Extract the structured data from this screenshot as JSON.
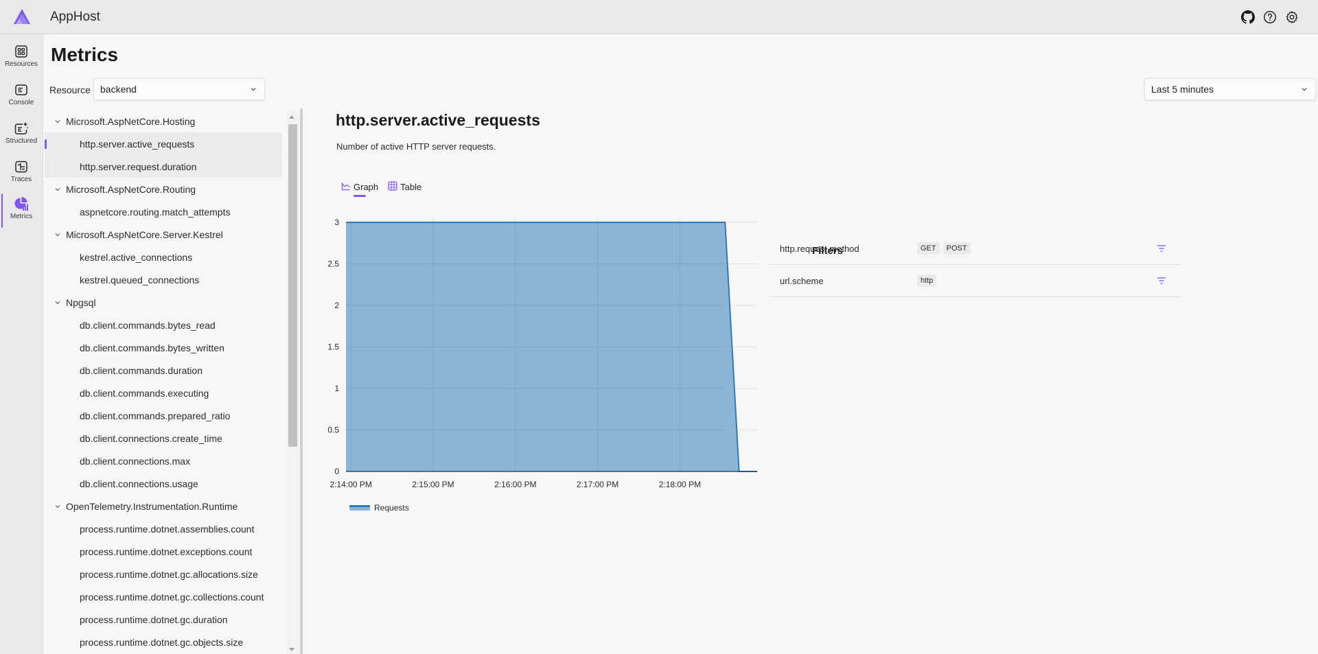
{
  "app": {
    "title": "AppHost"
  },
  "topbar": {
    "icons": [
      {
        "name": "github-icon",
        "label": "GitHub"
      },
      {
        "name": "help-icon",
        "label": "Help"
      },
      {
        "name": "settings-icon",
        "label": "Settings"
      }
    ]
  },
  "nav": {
    "items": [
      {
        "label": "Resources",
        "icon": "resources-icon",
        "active": false
      },
      {
        "label": "Console",
        "icon": "console-icon",
        "active": false
      },
      {
        "label": "Structured",
        "icon": "structured-logs-icon",
        "active": false
      },
      {
        "label": "Traces",
        "icon": "traces-icon",
        "active": false
      },
      {
        "label": "Metrics",
        "icon": "metrics-icon",
        "active": true
      }
    ]
  },
  "page": {
    "title": "Metrics",
    "resource_label": "Resource",
    "resource_value": "backend",
    "time_range": "Last 5 minutes"
  },
  "tree": {
    "rows": [
      {
        "type": "group",
        "label": "Microsoft.AspNetCore.Hosting"
      },
      {
        "type": "leaf",
        "label": "http.server.active_requests",
        "selected": true
      },
      {
        "type": "leaf",
        "label": "http.server.request.duration"
      },
      {
        "type": "group",
        "label": "Microsoft.AspNetCore.Routing"
      },
      {
        "type": "leaf",
        "label": "aspnetcore.routing.match_attempts"
      },
      {
        "type": "group",
        "label": "Microsoft.AspNetCore.Server.Kestrel"
      },
      {
        "type": "leaf",
        "label": "kestrel.active_connections"
      },
      {
        "type": "leaf",
        "label": "kestrel.queued_connections"
      },
      {
        "type": "group",
        "label": "Npgsql"
      },
      {
        "type": "leaf",
        "label": "db.client.commands.bytes_read"
      },
      {
        "type": "leaf",
        "label": "db.client.commands.bytes_written"
      },
      {
        "type": "leaf",
        "label": "db.client.commands.duration"
      },
      {
        "type": "leaf",
        "label": "db.client.commands.executing"
      },
      {
        "type": "leaf",
        "label": "db.client.commands.prepared_ratio"
      },
      {
        "type": "leaf",
        "label": "db.client.connections.create_time"
      },
      {
        "type": "leaf",
        "label": "db.client.connections.max"
      },
      {
        "type": "leaf",
        "label": "db.client.connections.usage"
      },
      {
        "type": "group",
        "label": "OpenTelemetry.Instrumentation.Runtime"
      },
      {
        "type": "leaf",
        "label": "process.runtime.dotnet.assemblies.count"
      },
      {
        "type": "leaf",
        "label": "process.runtime.dotnet.exceptions.count"
      },
      {
        "type": "leaf",
        "label": "process.runtime.dotnet.gc.allocations.size"
      },
      {
        "type": "leaf",
        "label": "process.runtime.dotnet.gc.collections.count"
      },
      {
        "type": "leaf",
        "label": "process.runtime.dotnet.gc.duration"
      },
      {
        "type": "leaf",
        "label": "process.runtime.dotnet.gc.objects.size"
      }
    ]
  },
  "metric": {
    "title": "http.server.active_requests",
    "description": "Number of active HTTP server requests.",
    "tabs": [
      {
        "label": "Graph",
        "icon": "chart-icon",
        "active": true
      },
      {
        "label": "Table",
        "icon": "table-icon",
        "active": false
      }
    ]
  },
  "filters": {
    "title": "Filters",
    "rows": [
      {
        "name": "http.request.method",
        "values": [
          "GET",
          "POST"
        ]
      },
      {
        "name": "url.scheme",
        "values": [
          "http"
        ]
      }
    ]
  },
  "colors": {
    "accent": "#7f56ef",
    "series_line": "#2e7bb8",
    "series_fill": "#8bb4d6"
  },
  "chart_data": {
    "type": "area",
    "title": "",
    "xlabel": "",
    "ylabel": "",
    "x_unit": "time",
    "x_ticks": [
      "2:14:00 PM",
      "2:15:00 PM",
      "2:16:00 PM",
      "2:17:00 PM",
      "2:18:00 PM"
    ],
    "x_tick_minutes": [
      0,
      1,
      2,
      3,
      4
    ],
    "xlim_minutes": [
      -0.06,
      4.94
    ],
    "y_ticks": [
      "0",
      "0.5",
      "1",
      "1.5",
      "2",
      "2.5",
      "3"
    ],
    "ylim": [
      0,
      3
    ],
    "grid": true,
    "legend_position": "bottom-left",
    "series": [
      {
        "name": "Requests",
        "x_minutes_from_2_14_00": [
          -0.06,
          4.55,
          4.72
        ],
        "values": [
          3,
          3,
          0
        ]
      }
    ]
  }
}
